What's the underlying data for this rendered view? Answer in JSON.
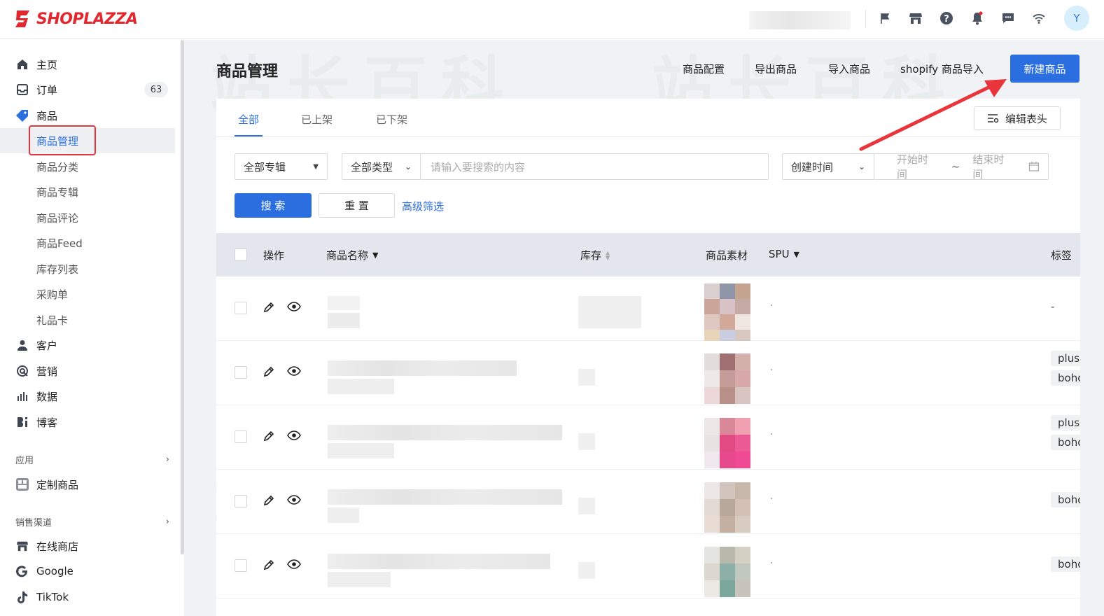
{
  "brand": {
    "name": "SHOPLAZZA",
    "color": "#e0282e"
  },
  "topbar": {
    "avatar_letter": "Y",
    "icons": [
      "flag-icon",
      "store-icon",
      "help-icon",
      "bell-icon",
      "message-icon",
      "wifi-icon"
    ]
  },
  "sidebar": {
    "items": [
      {
        "label": "主页",
        "icon": "home-icon"
      },
      {
        "label": "订单",
        "icon": "inbox-icon",
        "badge": "63"
      },
      {
        "label": "商品",
        "icon": "tag-icon"
      },
      {
        "label": "客户",
        "icon": "user-icon"
      },
      {
        "label": "营销",
        "icon": "marketing-icon"
      },
      {
        "label": "数据",
        "icon": "bar-chart-icon"
      },
      {
        "label": "博客",
        "icon": "blog-icon"
      }
    ],
    "product_sub": [
      "商品管理",
      "商品分类",
      "商品专辑",
      "商品评论",
      "商品Feed",
      "库存列表",
      "采购单",
      "礼品卡"
    ],
    "apps_header": "应用",
    "apps": [
      {
        "label": "定制商品",
        "icon": "app-icon"
      }
    ],
    "channels_header": "销售渠道",
    "channels": [
      {
        "label": "在线商店",
        "icon": "store-icon"
      },
      {
        "label": "Google",
        "icon": "google-icon"
      },
      {
        "label": "TikTok",
        "icon": "tiktok-icon"
      }
    ]
  },
  "header": {
    "title": "商品管理",
    "actions": [
      "商品配置",
      "导出商品",
      "导入商品",
      "shopify 商品导入"
    ],
    "primary": "新建商品"
  },
  "tabs": [
    "全部",
    "已上架",
    "已下架"
  ],
  "edit_columns": "编辑表头",
  "filters": {
    "collection": "全部专辑",
    "type": "全部类型",
    "search_placeholder": "请输入要搜索的内容",
    "time_field": "创建时间",
    "start_placeholder": "开始时间",
    "tilde": "~",
    "end_placeholder": "结束时间",
    "search_btn": "搜 索",
    "reset_btn": "重 置",
    "advanced": "高级筛选"
  },
  "table": {
    "columns": [
      "操作",
      "商品名称",
      "库存",
      "商品素材",
      "SPU",
      "标签"
    ],
    "rows": [
      {
        "spu": "·",
        "tags": [
          "-"
        ]
      },
      {
        "spu": "·",
        "tags": [
          "plus",
          "boho"
        ]
      },
      {
        "spu": "·",
        "tags": [
          "plus",
          "boho"
        ]
      },
      {
        "spu": "·",
        "tags": [
          "boho"
        ]
      },
      {
        "spu": "·",
        "tags": [
          "boho"
        ]
      }
    ]
  },
  "colors": {
    "accent": "#2b6ee0",
    "annotation": "#e8343b"
  }
}
